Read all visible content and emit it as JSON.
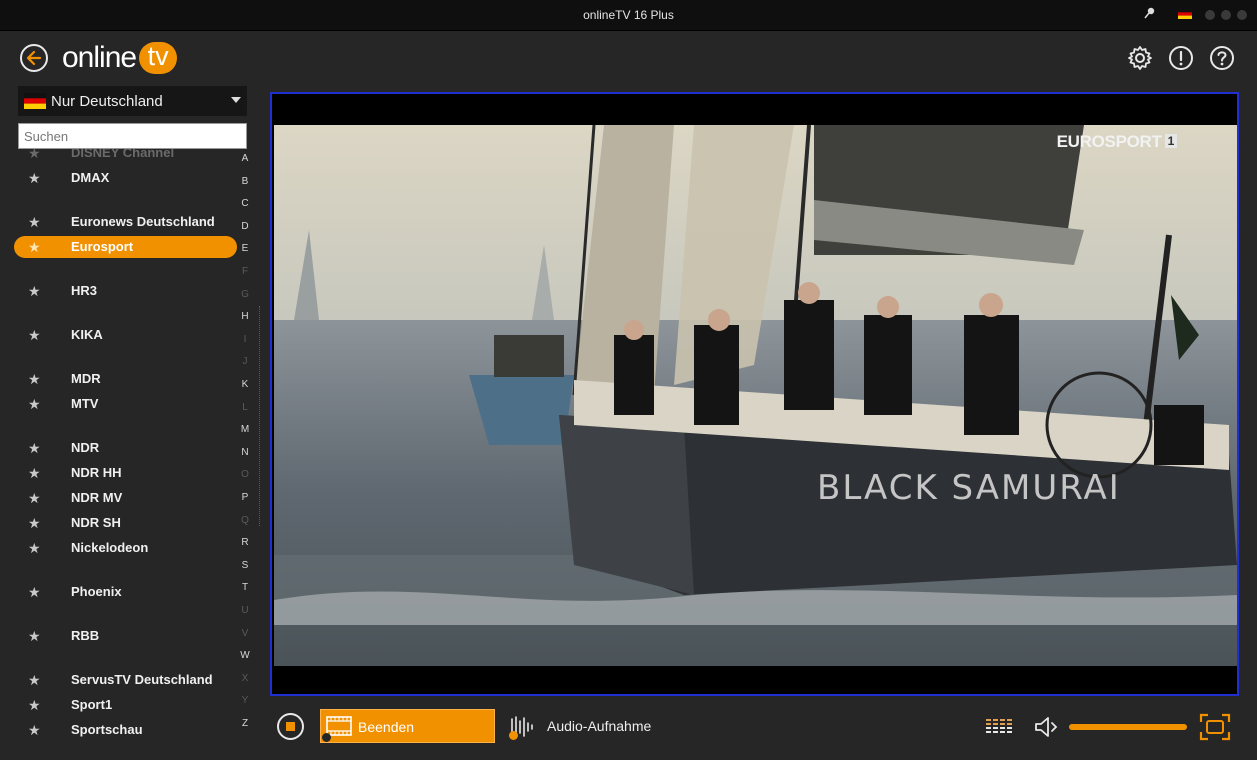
{
  "window": {
    "title": "onlineTV 16 Plus"
  },
  "header": {
    "logo_word": "online",
    "logo_tv": "tv"
  },
  "country": {
    "label": "Nur Deutschland"
  },
  "search": {
    "placeholder": "Suchen"
  },
  "channels": [
    {
      "name": "DISNEY Channel",
      "state": "faded"
    },
    {
      "name": "DMAX",
      "state": "normal"
    },
    {
      "name": "Euronews Deutschland",
      "state": "normal"
    },
    {
      "name": "Eurosport",
      "state": "selected"
    },
    {
      "name": "HR3",
      "state": "normal"
    },
    {
      "name": "KIKA",
      "state": "normal"
    },
    {
      "name": "MDR",
      "state": "normal"
    },
    {
      "name": "MTV",
      "state": "normal"
    },
    {
      "name": "NDR",
      "state": "normal"
    },
    {
      "name": "NDR HH",
      "state": "normal"
    },
    {
      "name": "NDR MV",
      "state": "normal"
    },
    {
      "name": "NDR SH",
      "state": "normal"
    },
    {
      "name": "Nickelodeon",
      "state": "normal"
    },
    {
      "name": "Phoenix",
      "state": "normal"
    },
    {
      "name": "RBB",
      "state": "normal"
    },
    {
      "name": "ServusTV Deutschland",
      "state": "normal"
    },
    {
      "name": "Sport1",
      "state": "normal"
    },
    {
      "name": "Sportschau",
      "state": "normal"
    }
  ],
  "alphabet": [
    {
      "letter": "A",
      "active": true
    },
    {
      "letter": "B",
      "active": true
    },
    {
      "letter": "C",
      "active": true
    },
    {
      "letter": "D",
      "active": true
    },
    {
      "letter": "E",
      "active": true
    },
    {
      "letter": "F",
      "active": false
    },
    {
      "letter": "G",
      "active": false
    },
    {
      "letter": "H",
      "active": true
    },
    {
      "letter": "I",
      "active": false
    },
    {
      "letter": "J",
      "active": false
    },
    {
      "letter": "K",
      "active": true
    },
    {
      "letter": "L",
      "active": false
    },
    {
      "letter": "M",
      "active": true
    },
    {
      "letter": "N",
      "active": true
    },
    {
      "letter": "O",
      "active": false
    },
    {
      "letter": "P",
      "active": true
    },
    {
      "letter": "Q",
      "active": false
    },
    {
      "letter": "R",
      "active": true
    },
    {
      "letter": "S",
      "active": true
    },
    {
      "letter": "T",
      "active": true
    },
    {
      "letter": "U",
      "active": false
    },
    {
      "letter": "V",
      "active": false
    },
    {
      "letter": "W",
      "active": true
    },
    {
      "letter": "X",
      "active": false
    },
    {
      "letter": "Y",
      "active": false
    },
    {
      "letter": "Z",
      "active": true
    }
  ],
  "video": {
    "channel_logo": "EUROSPORT",
    "channel_number": "1",
    "hull_text": "BLACK SAMURAI"
  },
  "controls": {
    "record_label": "Beenden",
    "audio_label": "Audio-Aufnahme",
    "volume_level": 1.0
  },
  "colors": {
    "accent": "#f29100",
    "player_border": "#2030d0",
    "background": "#262626"
  }
}
